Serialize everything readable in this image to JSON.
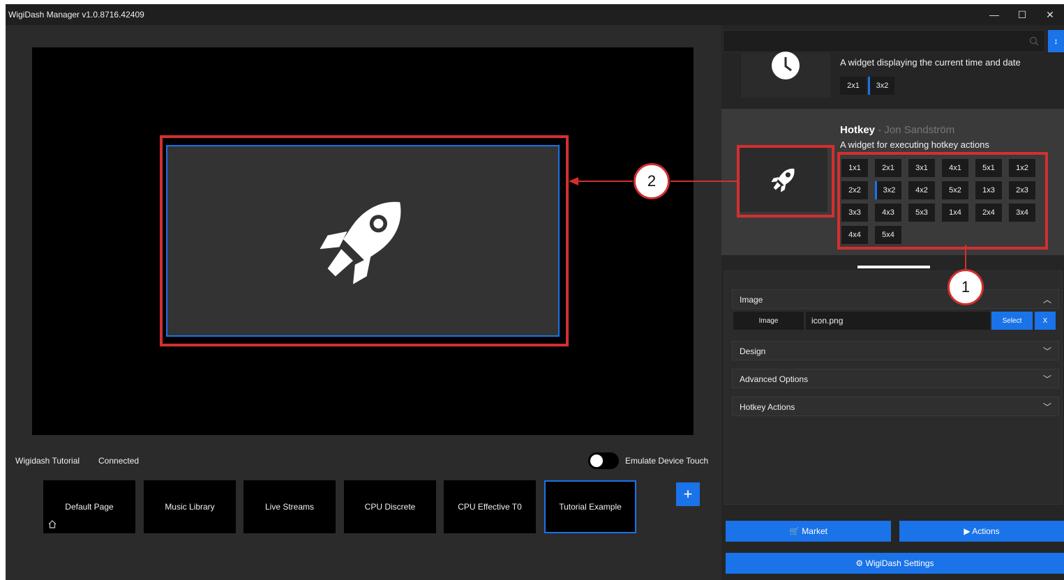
{
  "window": {
    "title": "WigiDash Manager v1.0.8716.42409",
    "minimize_glyph": "—",
    "maximize_glyph": "☐",
    "close_glyph": "✕"
  },
  "status": {
    "device_name": "Wigidash Tutorial",
    "connection": "Connected",
    "emulate_label": "Emulate Device Touch"
  },
  "pages": [
    {
      "label": "Default Page"
    },
    {
      "label": "Music Library"
    },
    {
      "label": "Live Streams"
    },
    {
      "label": "CPU Discrete"
    },
    {
      "label": "CPU Effective T0"
    },
    {
      "label": "Tutorial Example"
    }
  ],
  "add_page_glyph": "+",
  "widgets": {
    "clock": {
      "description": "A widget displaying the current time and date",
      "sizes": [
        "2x1",
        "3x2"
      ],
      "selected_size": "3x2"
    },
    "hotkey": {
      "name": "Hotkey",
      "author": " - Jon Sandström",
      "description": "A widget for executing hotkey actions",
      "sizes": [
        "1x1",
        "2x1",
        "3x1",
        "4x1",
        "5x1",
        "1x2",
        "2x2",
        "3x2",
        "4x2",
        "5x2",
        "1x3",
        "2x3",
        "3x3",
        "4x3",
        "5x3",
        "1x4",
        "2x4",
        "3x4",
        "4x4",
        "5x4"
      ],
      "selected_size": "3x2"
    }
  },
  "search": {
    "button_label": "↕"
  },
  "properties": {
    "image_section": "Image",
    "image_field_label": "Image",
    "image_field_value": "icon.png",
    "select_label": "Select",
    "clear_label": "X",
    "sections": [
      "Design",
      "Advanced Options",
      "Hotkey Actions"
    ],
    "chevron_up": "︿",
    "chevron_down": "﹀"
  },
  "buttons": {
    "market": "🛒 Market",
    "actions": "▶ Actions",
    "settings": "⚙ WigiDash Settings"
  },
  "callouts": [
    "1",
    "2"
  ],
  "colors": {
    "accent": "#1a73e8",
    "highlight": "#d32f2f"
  }
}
